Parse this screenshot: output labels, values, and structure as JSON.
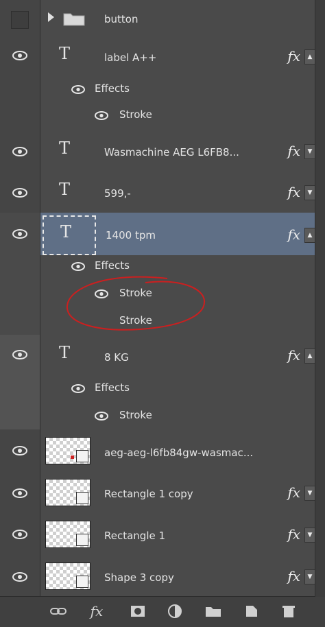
{
  "layers": {
    "button": {
      "name": "button"
    },
    "label_a": {
      "name": "label  A++",
      "effects_label": "Effects",
      "stroke_label": "Stroke"
    },
    "wasmachine": {
      "name": "Wasmachine AEG L6FB8..."
    },
    "price": {
      "name": "599,-"
    },
    "tpm": {
      "name": "1400 tpm",
      "effects_label": "Effects",
      "stroke_label_1": "Stroke",
      "stroke_label_2": "Stroke"
    },
    "kg": {
      "name": "8 KG",
      "effects_label": "Effects",
      "stroke_label": "Stroke"
    },
    "image": {
      "name": "aeg-aeg-l6fb84gw-wasmac..."
    },
    "rect1copy": {
      "name": "Rectangle 1 copy"
    },
    "rect1": {
      "name": "Rectangle 1"
    },
    "shape3copy": {
      "name": "Shape 3 copy"
    }
  },
  "icons": {
    "visibility": "eye-icon",
    "type_layer": "T",
    "fx": "fx",
    "folder": "folder-icon",
    "link": "link-icon",
    "mask": "mask-icon",
    "adjustment": "adjustment-icon",
    "new_group": "folder-icon",
    "new_layer": "new-layer-icon",
    "delete": "trash-icon"
  },
  "colors": {
    "selected_row": "#5f6f86",
    "annotation": "#cc1f1f",
    "panel_bg": "#4a4a4a"
  }
}
